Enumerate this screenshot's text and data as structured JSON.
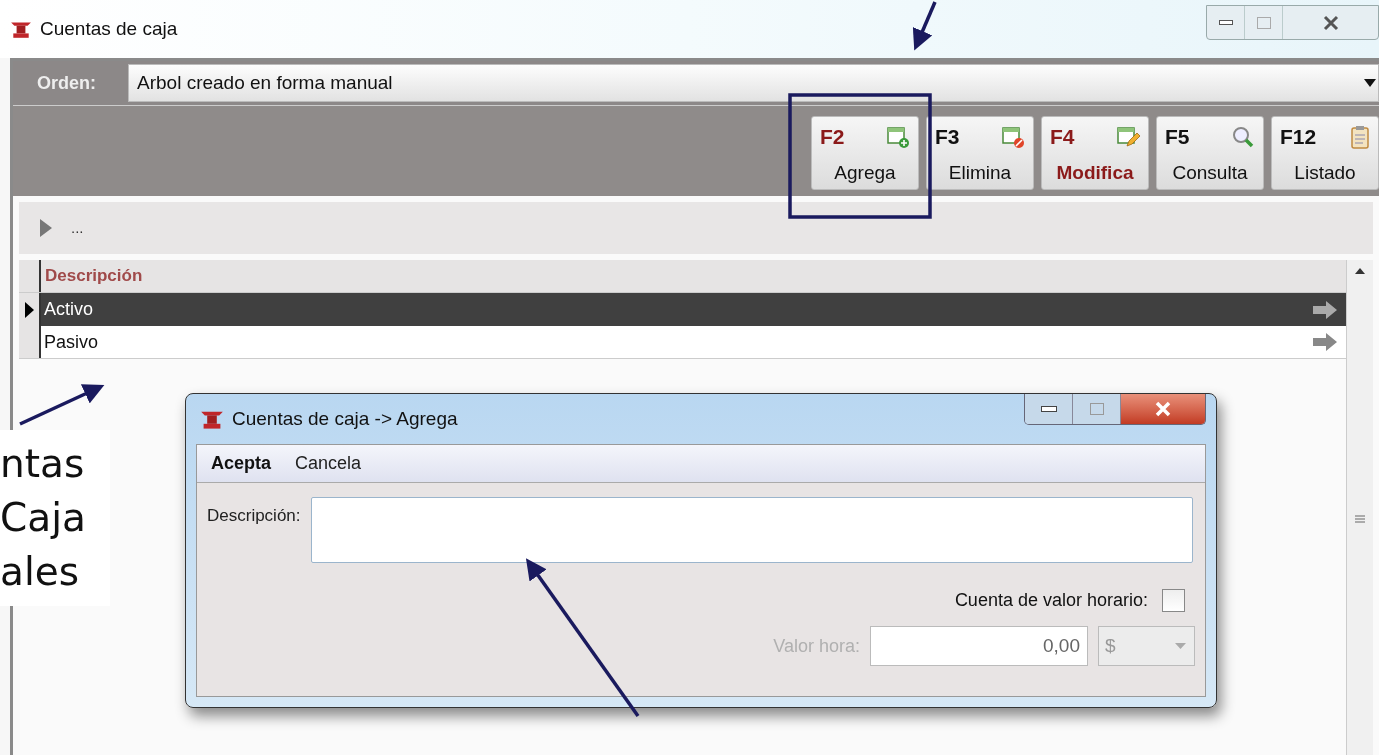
{
  "window": {
    "title": "Cuentas de caja"
  },
  "order": {
    "label": "Orden:",
    "value": "Arbol creado en forma manual"
  },
  "toolbar": [
    {
      "key": "F2",
      "label": "Agrega",
      "color": "#8b1a1a",
      "emphasized": false,
      "kind": "add"
    },
    {
      "key": "F3",
      "label": "Elimina",
      "color": "#111111",
      "emphasized": false,
      "kind": "delete"
    },
    {
      "key": "F4",
      "label": "Modifica",
      "color": "#8b1a1a",
      "emphasized": true,
      "kind": "edit"
    },
    {
      "key": "F5",
      "label": "Consulta",
      "color": "#111111",
      "emphasized": false,
      "kind": "search"
    },
    {
      "key": "F12",
      "label": "Listado",
      "color": "#111111",
      "emphasized": false,
      "kind": "list"
    }
  ],
  "breadcrumb": "...",
  "table": {
    "column": "Descripción",
    "rows": [
      {
        "text": "Activo",
        "selected": true
      },
      {
        "text": "Pasivo",
        "selected": false
      }
    ]
  },
  "dialog": {
    "title": "Cuentas de caja -> Agrega",
    "menu": [
      {
        "label": "Acepta",
        "default": true
      },
      {
        "label": "Cancela",
        "default": false
      }
    ],
    "description_label": "Descripción:",
    "hourly": {
      "label": "Cuenta de valor horario:",
      "checked": false
    },
    "rate": {
      "label": "Valor hora:",
      "value": "0,00",
      "currency": "$",
      "disabled": true
    }
  },
  "callout": [
    "ntas",
    "Caja",
    "ales"
  ]
}
